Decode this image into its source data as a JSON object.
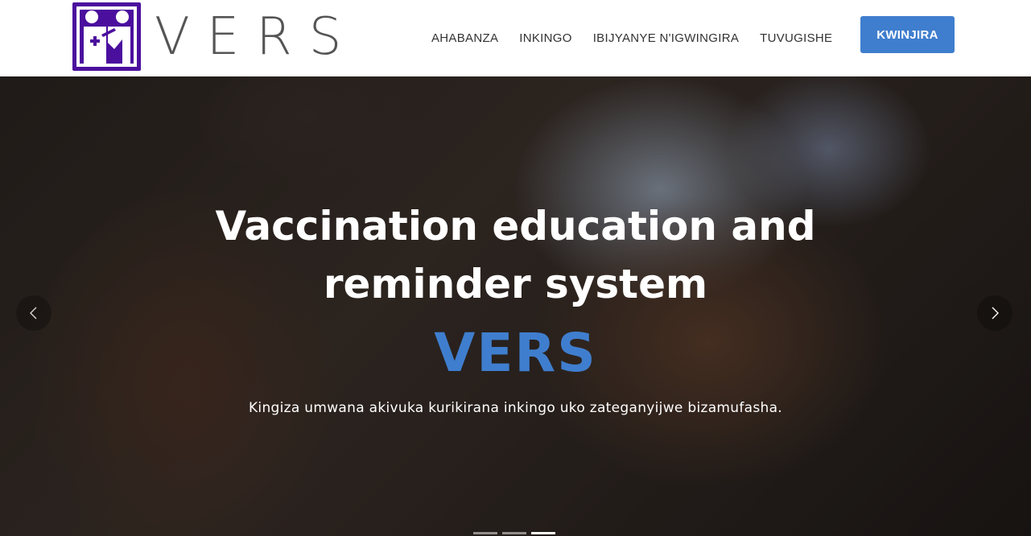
{
  "brand": {
    "name": "VERS",
    "logo_icon": "vaccination-logo-icon",
    "logo_color": "#4b0f9e"
  },
  "nav": {
    "items": [
      "AHABANZA",
      "INKINGO",
      "IBIJYANYE N'IGWINGIRA",
      "TUVUGISHE"
    ],
    "cta_label": "KWINJIRA",
    "cta_color": "#3f7ece"
  },
  "hero": {
    "title_line1": "Vaccination education and",
    "title_line2": "reminder system",
    "brand": "VERS",
    "subtitle": "Kingiza umwana akivuka kurikirana inkingo uko zateganyijwe bizamufasha.",
    "accent_color": "#3f7ece",
    "slides_total": 3,
    "active_slide": 3,
    "prev_icon": "chevron-left-icon",
    "next_icon": "chevron-right-icon"
  }
}
